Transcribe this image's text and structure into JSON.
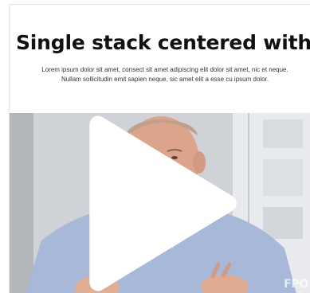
{
  "section": {
    "title": "Single stack centered with video",
    "description": "Lorem ipsum dolor sit amet, consect sit amet adipiscing elit dolor sit amet, nic et neque. Nullam sollicitudin emit sapien neque, sic amet elit a esse cu ipsum dolor."
  },
  "video": {
    "play_icon": "play-icon",
    "watermark": "FPO"
  }
}
